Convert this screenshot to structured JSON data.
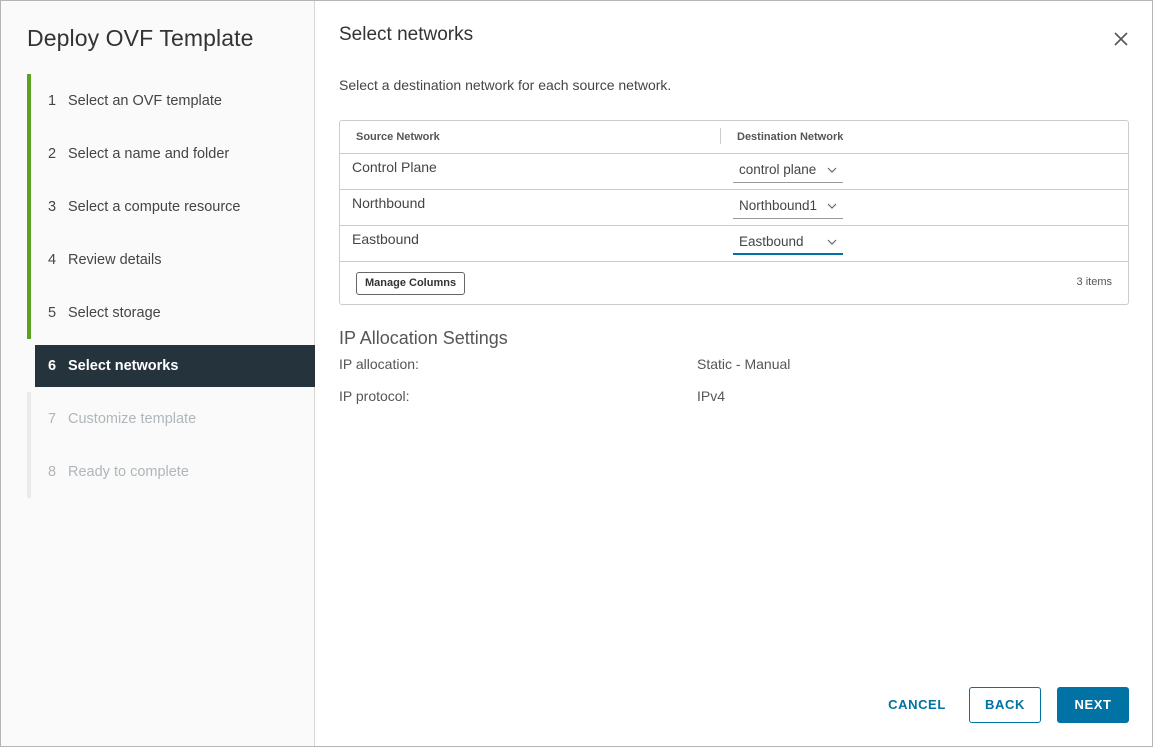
{
  "wizard": {
    "title": "Deploy OVF Template",
    "steps": [
      {
        "num": "1",
        "label": "Select an OVF template"
      },
      {
        "num": "2",
        "label": "Select a name and folder"
      },
      {
        "num": "3",
        "label": "Select a compute resource"
      },
      {
        "num": "4",
        "label": "Review details"
      },
      {
        "num": "5",
        "label": "Select storage"
      },
      {
        "num": "6",
        "label": "Select networks"
      },
      {
        "num": "7",
        "label": "Customize template"
      },
      {
        "num": "8",
        "label": "Ready to complete"
      }
    ]
  },
  "page": {
    "title": "Select networks",
    "subtitle": "Select a destination network for each source network."
  },
  "grid": {
    "headers": {
      "source": "Source Network",
      "destination": "Destination Network"
    },
    "rows": [
      {
        "source": "Control Plane",
        "destination": "control plane"
      },
      {
        "source": "Northbound",
        "destination": "Northbound1"
      },
      {
        "source": "Eastbound",
        "destination": "Eastbound"
      }
    ],
    "manage_columns": "Manage Columns",
    "count": "3 items"
  },
  "ip": {
    "title": "IP Allocation Settings",
    "allocation_label": "IP allocation:",
    "allocation_value": "Static - Manual",
    "protocol_label": "IP protocol:",
    "protocol_value": "IPv4"
  },
  "buttons": {
    "cancel": "CANCEL",
    "back": "BACK",
    "next": "NEXT"
  },
  "colors": {
    "accent": "#0072a3",
    "complete": "#5aa220",
    "current_step_bg": "#25333d"
  },
  "icons": {
    "close": "close-icon",
    "dropdown": "chevron-down-icon"
  }
}
